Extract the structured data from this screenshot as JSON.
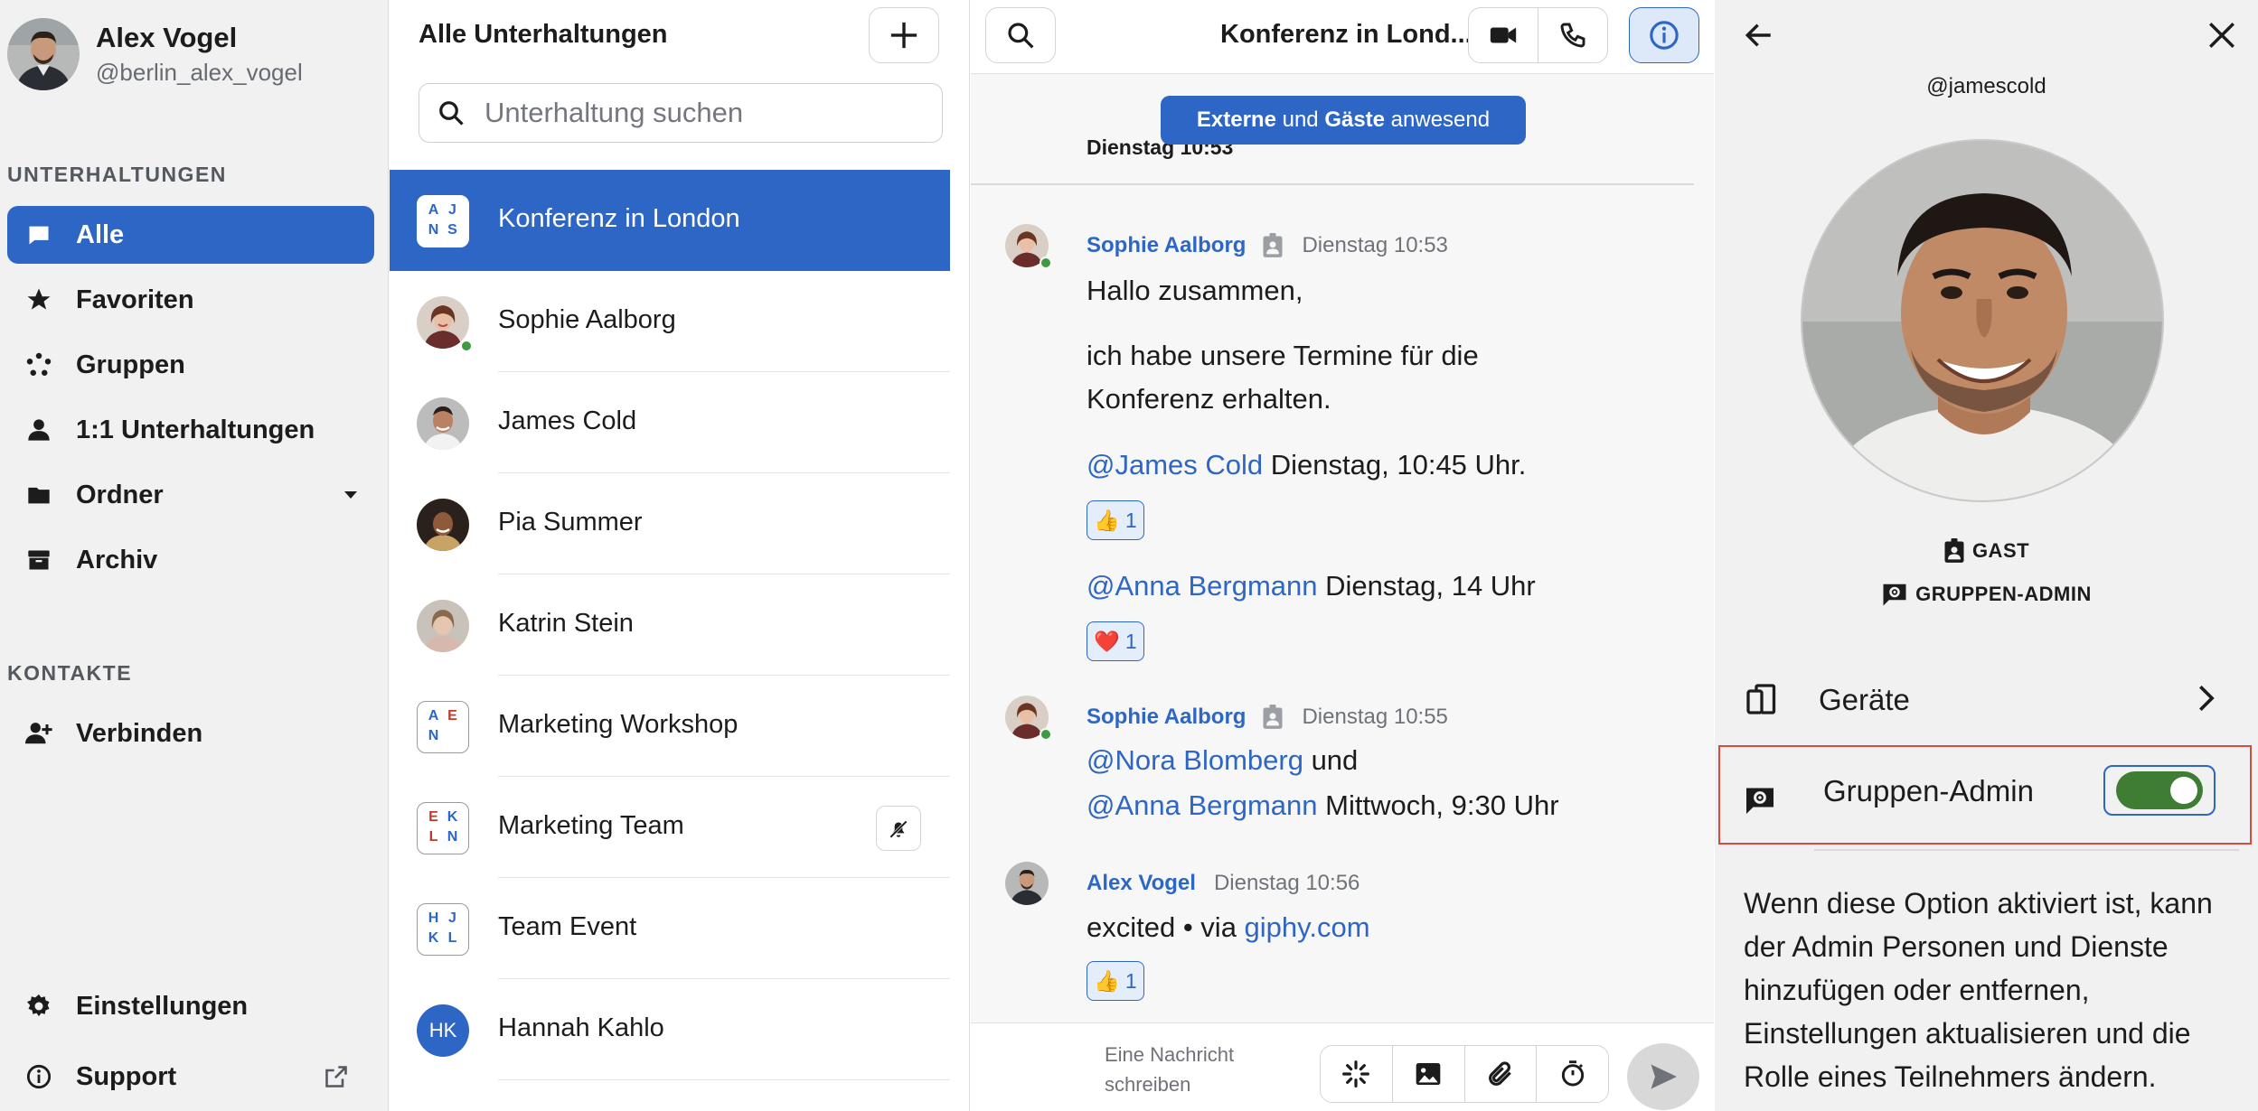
{
  "colors": {
    "accent": "#2d66c4",
    "online": "#3e9a42",
    "toggle_on": "#3e7d33",
    "highlight_border": "#d84a3c"
  },
  "user": {
    "name": "Alex Vogel",
    "handle": "@berlin_alex_vogel"
  },
  "sidebar": {
    "conversations_label": "UNTERHALTUNGEN",
    "items": [
      {
        "label": "Alle",
        "icon": "chat-bubble-icon",
        "active": true
      },
      {
        "label": "Favoriten",
        "icon": "star-icon"
      },
      {
        "label": "Gruppen",
        "icon": "group-dots-icon"
      },
      {
        "label": "1:1 Unterhaltungen",
        "icon": "person-icon"
      },
      {
        "label": "Ordner",
        "icon": "folder-icon",
        "expandable": true
      },
      {
        "label": "Archiv",
        "icon": "archive-icon"
      }
    ],
    "contacts_label": "KONTAKTE",
    "connect_label": "Verbinden",
    "settings_label": "Einstellungen",
    "support_label": "Support"
  },
  "conversation_list": {
    "title": "Alle Unterhaltungen",
    "search_placeholder": "Unterhaltung suchen",
    "items": [
      {
        "name": "Konferenz in London",
        "type": "group",
        "initials": [
          "A",
          "J",
          "N",
          "S"
        ],
        "active": true
      },
      {
        "name": "Sophie Aalborg",
        "type": "person",
        "online": true
      },
      {
        "name": "James Cold",
        "type": "person"
      },
      {
        "name": "Pia Summer",
        "type": "person"
      },
      {
        "name": "Katrin Stein",
        "type": "person"
      },
      {
        "name": "Marketing Workshop",
        "type": "group",
        "initials": [
          "A",
          "E",
          "N",
          ""
        ]
      },
      {
        "name": "Marketing Team",
        "type": "group",
        "initials": [
          "E",
          "K",
          "L",
          "N"
        ],
        "muted": true
      },
      {
        "name": "Team Event",
        "type": "group",
        "initials": [
          "H",
          "J",
          "K",
          "L"
        ]
      },
      {
        "name": "Hannah Kahlo",
        "type": "initials",
        "initials_text": "HK"
      }
    ]
  },
  "chat": {
    "title": "Konferenz in Lond...",
    "banner": {
      "part1": "Externe",
      "part2": " und ",
      "part3": "Gäste",
      "part4": " anwesend"
    },
    "date_separator": "Dienstag 10:53",
    "messages": [
      {
        "author": "Sophie Aalborg",
        "time": "Dienstag 10:53",
        "guest_badge": true,
        "line1": "Hallo zusammen,",
        "line2": "ich habe unsere Termine für die",
        "line3": "Konferenz erhalten.",
        "mention1": "@James Cold",
        "text1": " Dienstag, 10:45 Uhr.",
        "reaction1": {
          "emoji": "👍",
          "count": "1"
        },
        "mention2": "@Anna Bergmann",
        "text2": " Dienstag, 14 Uhr",
        "reaction2": {
          "emoji": "❤️",
          "count": "1"
        }
      },
      {
        "author": "Sophie Aalborg",
        "time": "Dienstag 10:55",
        "guest_badge": true,
        "mention1": "@Nora Blomberg",
        "text1": " und",
        "mention2": "@Anna Bergmann",
        "text2": " Mittwoch, 9:30 Uhr"
      },
      {
        "author": "Alex Vogel",
        "time": "Dienstag 10:56",
        "text": "excited • via ",
        "link": "giphy.com",
        "reaction": {
          "emoji": "👍",
          "count": "1"
        }
      }
    ],
    "composer_placeholder": "Eine Nachricht schreiben"
  },
  "panel": {
    "handle": "@jamescold",
    "role_guest": "GAST",
    "role_admin": "GRUPPEN-ADMIN",
    "devices_label": "Geräte",
    "admin_toggle_label": "Gruppen-Admin",
    "admin_toggle_on": true,
    "description": "Wenn diese Option aktiviert ist, kann der Admin Personen und Dienste hinzufügen oder entfernen, Einstellungen aktualisieren und die Rolle eines Teilnehmers ändern."
  }
}
